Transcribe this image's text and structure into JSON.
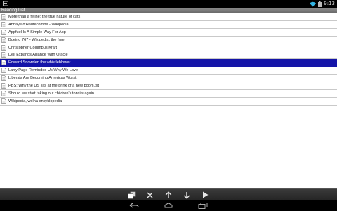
{
  "status": {
    "time": "9:13"
  },
  "app": {
    "title": "Reading List"
  },
  "list": {
    "items": [
      {
        "label": "More than a feline: the true nature of cats",
        "selected": false
      },
      {
        "label": "Abbaye d'Hautecombe - Wikipedia",
        "selected": false
      },
      {
        "label": "Appfuel Is A Simple Way For App",
        "selected": false
      },
      {
        "label": "Boeing 767 - Wikipedia, the free",
        "selected": false
      },
      {
        "label": "Christopher Columbus Kraft",
        "selected": false
      },
      {
        "label": "Dell Expands Alliance With Oracle",
        "selected": false
      },
      {
        "label": "Edward Snowden the whistleblower",
        "selected": true
      },
      {
        "label": "Larry Page Reminded Us Why We Love",
        "selected": false
      },
      {
        "label": "Liberals Are Becoming Americas Worst",
        "selected": false
      },
      {
        "label": "PBS: Why the US sits at the brink of a new boom.txt",
        "selected": false
      },
      {
        "label": "Should we start taking out children's tonsils again",
        "selected": false
      },
      {
        "label": "Wikipedia, wolna encyklopedia",
        "selected": false
      }
    ]
  },
  "toolbar": {
    "buttons": [
      "copy-icon",
      "close-icon",
      "arrow-up-icon",
      "arrow-down-icon",
      "play-icon"
    ]
  },
  "colors": {
    "selected_bg": "#1414a8",
    "titlebar": "#7a7a7a",
    "status_accent": "#33b5e5"
  }
}
